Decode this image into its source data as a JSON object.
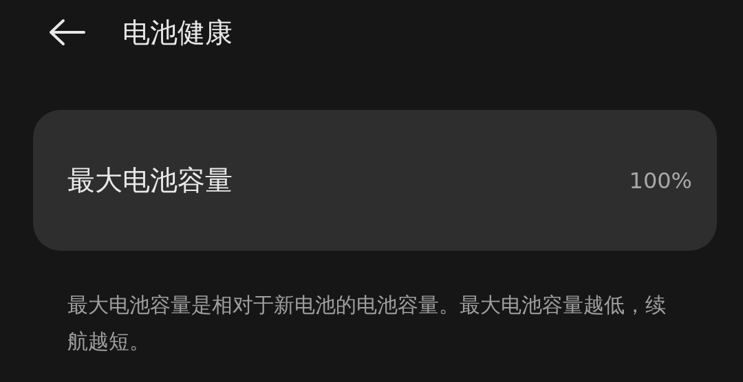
{
  "header": {
    "title": "电池健康"
  },
  "card": {
    "label": "最大电池容量",
    "value": "100%"
  },
  "description": "最大电池容量是相对于新电池的电池容量。最大电池容量越低，续航越短。"
}
